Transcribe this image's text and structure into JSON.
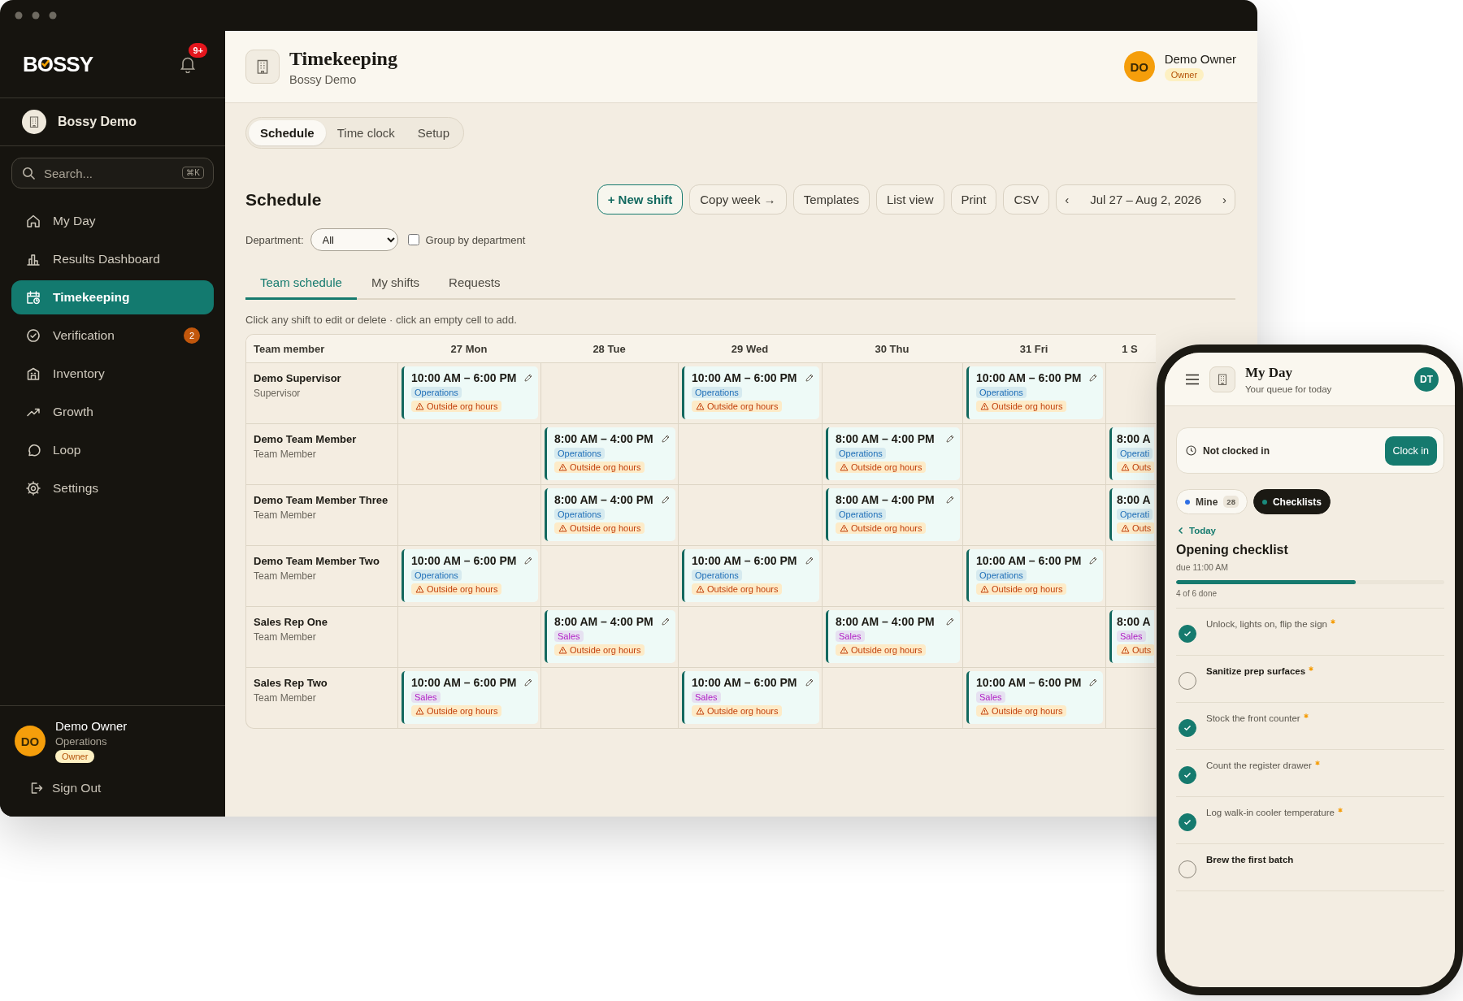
{
  "sidebar": {
    "logo": "BOSSY",
    "notification_badge": "9+",
    "workspace": "Bossy Demo",
    "search": {
      "placeholder": "Search...",
      "shortcut": "⌘K"
    },
    "nav": [
      {
        "label": "My Day",
        "selected": false
      },
      {
        "label": "Results Dashboard",
        "selected": false
      },
      {
        "label": "Timekeeping",
        "selected": true
      },
      {
        "label": "Verification",
        "selected": false,
        "badge": "2"
      },
      {
        "label": "Inventory",
        "selected": false
      },
      {
        "label": "Growth",
        "selected": false
      },
      {
        "label": "Loop",
        "selected": false
      },
      {
        "label": "Settings",
        "selected": false
      }
    ],
    "user": {
      "initials": "DO",
      "name": "Demo Owner",
      "department": "Operations",
      "role": "Owner"
    },
    "sign_out": "Sign Out"
  },
  "header": {
    "title": "Timekeeping",
    "subtitle": "Bossy Demo",
    "user": {
      "initials": "DO",
      "name": "Demo Owner",
      "role": "Owner"
    }
  },
  "tabs": [
    {
      "label": "Schedule",
      "selected": true
    },
    {
      "label": "Time clock",
      "selected": false
    },
    {
      "label": "Setup",
      "selected": false
    }
  ],
  "schedule": {
    "heading": "Schedule",
    "actions": [
      {
        "label": "+ New shift",
        "kind": "primary"
      },
      {
        "label": "Copy week →",
        "kind": "default"
      },
      {
        "label": "Templates",
        "kind": "default"
      },
      {
        "label": "List view",
        "kind": "default"
      },
      {
        "label": "Print",
        "kind": "default"
      },
      {
        "label": "CSV",
        "kind": "default"
      }
    ],
    "date_range": {
      "prev": "‹",
      "label": "Jul 27 – Aug 2, 2026",
      "next": "›"
    },
    "filter": {
      "label": "Department:",
      "value": "All"
    },
    "group_by": {
      "label": "Group by department",
      "checked": false
    },
    "subtabs": [
      {
        "label": "Team schedule",
        "selected": true
      },
      {
        "label": "My shifts",
        "selected": false
      },
      {
        "label": "Requests",
        "selected": false
      }
    ],
    "hint": "Click any shift to edit or delete · click an empty cell to add.",
    "table": {
      "member_column": "Team member",
      "columns": [
        "27 Mon",
        "28 Tue",
        "29 Wed",
        "30 Thu",
        "31 Fri",
        "1 S"
      ],
      "rows": [
        {
          "name": "Demo Supervisor",
          "role": "Supervisor",
          "cells": [
            {
              "kind": "shift",
              "time": "10:00 AM – 6:00 PM",
              "tag": {
                "label": "Operations",
                "color": "#1f6fb8"
              },
              "warning": "Outside org hours"
            },
            {
              "kind": "empty"
            },
            {
              "kind": "shift",
              "time": "10:00 AM – 6:00 PM",
              "tag": {
                "label": "Operations",
                "color": "#1f6fb8"
              },
              "warning": "Outside org hours"
            },
            {
              "kind": "empty"
            },
            {
              "kind": "shift",
              "time": "10:00 AM – 6:00 PM",
              "tag": {
                "label": "Operations",
                "color": "#1f6fb8"
              },
              "warning": "Outside org hours"
            },
            {
              "kind": "empty"
            }
          ]
        },
        {
          "name": "Demo Team Member",
          "role": "Team Member",
          "cells": [
            {
              "kind": "empty"
            },
            {
              "kind": "shift",
              "time": "8:00 AM – 4:00 PM",
              "tag": {
                "label": "Operations",
                "color": "#1f6fb8"
              },
              "warning": "Outside org hours"
            },
            {
              "kind": "empty"
            },
            {
              "kind": "shift",
              "time": "8:00 AM – 4:00 PM",
              "tag": {
                "label": "Operations",
                "color": "#1f6fb8"
              },
              "warning": "Outside org hours"
            },
            {
              "kind": "empty"
            },
            {
              "kind": "partial",
              "time": "8:00 A",
              "tag": {
                "label": "Operati",
                "color": "#1f6fb8"
              },
              "warning": "Outs"
            }
          ]
        },
        {
          "name": "Demo Team Member Three",
          "role": "Team Member",
          "cells": [
            {
              "kind": "empty"
            },
            {
              "kind": "shift",
              "time": "8:00 AM – 4:00 PM",
              "tag": {
                "label": "Operations",
                "color": "#1f6fb8"
              },
              "warning": "Outside org hours"
            },
            {
              "kind": "empty"
            },
            {
              "kind": "shift",
              "time": "8:00 AM – 4:00 PM",
              "tag": {
                "label": "Operations",
                "color": "#1f6fb8"
              },
              "warning": "Outside org hours"
            },
            {
              "kind": "empty"
            },
            {
              "kind": "partial",
              "time": "8:00 A",
              "tag": {
                "label": "Operati",
                "color": "#1f6fb8"
              },
              "warning": "Outs"
            }
          ]
        },
        {
          "name": "Demo Team Member Two",
          "role": "Team Member",
          "cells": [
            {
              "kind": "shift",
              "time": "10:00 AM – 6:00 PM",
              "tag": {
                "label": "Operations",
                "color": "#1f6fb8"
              },
              "warning": "Outside org hours"
            },
            {
              "kind": "empty"
            },
            {
              "kind": "shift",
              "time": "10:00 AM – 6:00 PM",
              "tag": {
                "label": "Operations",
                "color": "#1f6fb8"
              },
              "warning": "Outside org hours"
            },
            {
              "kind": "empty"
            },
            {
              "kind": "shift",
              "time": "10:00 AM – 6:00 PM",
              "tag": {
                "label": "Operations",
                "color": "#1f6fb8"
              },
              "warning": "Outside org hours"
            },
            {
              "kind": "empty"
            }
          ]
        },
        {
          "name": "Sales Rep One",
          "role": "Team Member",
          "cells": [
            {
              "kind": "empty"
            },
            {
              "kind": "shift",
              "time": "8:00 AM – 4:00 PM",
              "tag": {
                "label": "Sales",
                "color": "#b01cc4"
              },
              "warning": "Outside org hours"
            },
            {
              "kind": "empty"
            },
            {
              "kind": "shift",
              "time": "8:00 AM – 4:00 PM",
              "tag": {
                "label": "Sales",
                "color": "#b01cc4"
              },
              "warning": "Outside org hours"
            },
            {
              "kind": "empty"
            },
            {
              "kind": "partial",
              "time": "8:00 A",
              "tag": {
                "label": "Sales",
                "color": "#b01cc4"
              },
              "warning": "Outs"
            }
          ]
        },
        {
          "name": "Sales Rep Two",
          "role": "Team Member",
          "cells": [
            {
              "kind": "shift",
              "time": "10:00 AM – 6:00 PM",
              "tag": {
                "label": "Sales",
                "color": "#b01cc4"
              },
              "warning": "Outside org hours"
            },
            {
              "kind": "empty"
            },
            {
              "kind": "shift",
              "time": "10:00 AM – 6:00 PM",
              "tag": {
                "label": "Sales",
                "color": "#b01cc4"
              },
              "warning": "Outside org hours"
            },
            {
              "kind": "empty"
            },
            {
              "kind": "shift",
              "time": "10:00 AM – 6:00 PM",
              "tag": {
                "label": "Sales",
                "color": "#b01cc4"
              },
              "warning": "Outside org hours"
            },
            {
              "kind": "empty"
            }
          ]
        }
      ]
    }
  },
  "phone": {
    "title": "My Day",
    "subtitle": "Your queue for today",
    "avatar": "DT",
    "clock": {
      "status": "Not clocked in",
      "button": "Clock in"
    },
    "filters": [
      {
        "label": "Mine",
        "count": "28",
        "color": "#2f6fe4",
        "selected": false
      },
      {
        "label": "Checklists",
        "color": "#1a8a7c",
        "selected": true
      }
    ],
    "back": "Today",
    "checklist": {
      "title": "Opening checklist",
      "due": "due 11:00 AM",
      "level": 0.67,
      "progress": "4 of 6 done",
      "items": [
        {
          "label": "Unlock, lights on, flip the sign",
          "checked": true,
          "required": true
        },
        {
          "label": "Sanitize prep surfaces",
          "checked": false,
          "required": true
        },
        {
          "label": "Stock the front counter",
          "checked": true,
          "required": true
        },
        {
          "label": "Count the register drawer",
          "checked": true,
          "required": true
        },
        {
          "label": "Log walk-in cooler temperature",
          "checked": true,
          "required": true
        },
        {
          "label": "Brew the first batch",
          "checked": false,
          "required": false
        }
      ]
    }
  }
}
